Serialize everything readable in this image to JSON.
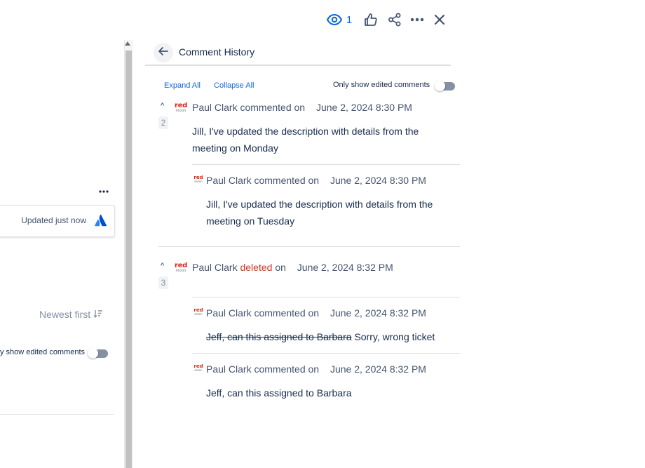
{
  "toolbar": {
    "watch_count": "1",
    "watch_icon": "eye-icon",
    "like_icon": "thumbs-up-icon",
    "share_icon": "share-icon",
    "more_icon": "more-horizontal-icon",
    "close_icon": "close-icon",
    "accent": "#0c66e4"
  },
  "left_panel": {
    "updated_text": "Updated just now",
    "sort_label": "Newest first",
    "toggle_label": "y show edited comments"
  },
  "history": {
    "title": "Comment History",
    "expand_all": "Expand All",
    "collapse_all": "Collapse All",
    "only_edited_label": "Only show edited comments",
    "groups": [
      {
        "count": "2",
        "author": "Paul Clark",
        "verb": "commented on",
        "date": "June 2, 2024 8:30 PM",
        "text": "Jill, I've updated the description with details from the meeting on Monday",
        "versions": [
          {
            "author": "Paul Clark",
            "verb": "commented on",
            "date": "June 2, 2024 8:30 PM",
            "text": "Jill, I've updated the description with details from the meeting on Tuesday"
          }
        ]
      },
      {
        "count": "3",
        "author": "Paul Clark",
        "verb": "deleted",
        "verb_suffix": "on",
        "date": "June 2, 2024 8:32 PM",
        "versions": [
          {
            "author": "Paul Clark",
            "verb": "commented on",
            "date": "June 2, 2024 8:32 PM",
            "struck_text": "Jeff, can this assigned to Barbara",
            "text": "Sorry, wrong ticket"
          },
          {
            "author": "Paul Clark",
            "verb": "commented on",
            "date": "June 2, 2024 8:32 PM",
            "text": "Jeff, can this assigned to Barbara"
          }
        ]
      }
    ]
  },
  "avatar": {
    "line1": "red",
    "line2": "moon"
  },
  "colors": {
    "deleted": "#c9372c",
    "link": "#0c66e4",
    "text": "#172b4d",
    "muted": "#44546f"
  }
}
